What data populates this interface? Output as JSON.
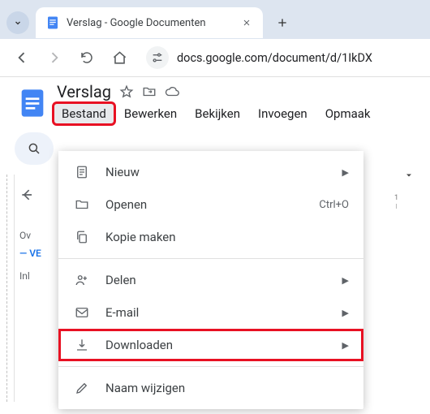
{
  "browser": {
    "tab_title": "Verslag - Google Documenten",
    "url": "docs.google.com/document/d/1IkDX"
  },
  "docs": {
    "title": "Verslag",
    "menu": {
      "bestand": "Bestand",
      "bewerken": "Bewerken",
      "bekijken": "Bekijken",
      "invoegen": "Invoegen",
      "opmaak": "Opmaak"
    }
  },
  "dropdown": {
    "nieuw": "Nieuw",
    "openen": "Openen",
    "openen_shortcut": "Ctrl+O",
    "kopie": "Kopie maken",
    "delen": "Delen",
    "email": "E-mail",
    "downloaden": "Downloaden",
    "naam_wijzigen": "Naam wijzigen"
  },
  "outline": {
    "overview_prefix": "Ov",
    "heading": "VE",
    "sub": "Inl"
  },
  "ruler": {
    "one": "1"
  }
}
